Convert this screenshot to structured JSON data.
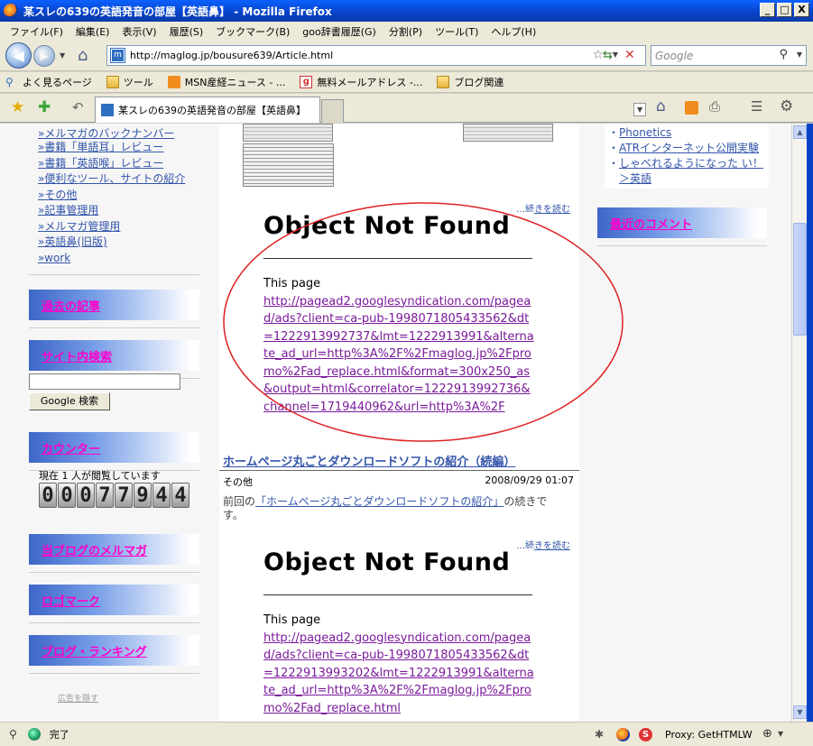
{
  "window": {
    "title": "某スレの639の英語発音の部屋【英語鼻】 - Mozilla Firefox",
    "min": "_",
    "max": "□",
    "close": "X"
  },
  "menu": [
    "ファイル(F)",
    "編集(E)",
    "表示(V)",
    "履歴(S)",
    "ブックマーク(B)",
    "goo辞書履歴(G)",
    "分割(P)",
    "ツール(T)",
    "ヘルプ(H)"
  ],
  "nav": {
    "url": "http://maglog.jp/bousure639/Article.html",
    "search_placeholder": "Google"
  },
  "bookmarks": [
    "よく見るページ",
    "ツール",
    "MSN産経ニュース - ...",
    "無料メールアドレス -...",
    "ブログ関連"
  ],
  "tab": {
    "label": "某スレの639の英語発音の部屋【英語鼻】"
  },
  "left_sidebar": {
    "links": [
      "»メルマガのバックナンバー",
      "»書籍「単語耳」レビュー",
      "»書籍「英語喉」レビュー",
      "»便利なツール、サイトの紹介",
      "»その他",
      "»記事管理用",
      "»メルマガ管理用",
      "»英語鼻(旧版)",
      "»work"
    ],
    "past_articles": "過去の記事",
    "site_search": "サイト内検索",
    "search_button": "Google 検索",
    "counter_title": "カウンター",
    "counter_text": "現在 1 人が閲覧しています",
    "counter_digits": "00077944",
    "mailmag": "当ブログのメルマガ",
    "logo": "ロゴマーク",
    "ranking": "ブログ・ランキング",
    "hide_ad": "広告を隠す"
  },
  "main": {
    "more1": "…続きを読む",
    "error1": {
      "title": "Object Not Found",
      "intro": "This page",
      "url": "http://pagead2.googlesyndication.com/pagead/ads?client=ca-pub-1998071805433562&dt=1222913992737&lmt=1222913991&alternate_ad_url=http%3A%2F%2Fmaglog.jp%2Fpromo%2Fad_replace.html&format=300x250_as&output=html&correlator=1222913992736&channel=1719440962&url=http%3A%2F"
    },
    "article_title": "ホームページ丸ごとダウンロードソフトの紹介（続編）",
    "category": "その他",
    "date": "2008/09/29 01:07",
    "body_prefix": "前回の",
    "body_link": "「ホームページ丸ごとダウンロードソフトの紹介」",
    "body_suffix": "の続きです。",
    "more2": "…続きを読む",
    "error2": {
      "title": "Object Not Found",
      "intro": "This page",
      "url": "http://pagead2.googlesyndication.com/pagead/ads?client=ca-pub-1998071805433562&dt=1222913993202&lmt=1222913991&alternate_ad_url=http%3A%2F%2Fmaglog.jp%2Fpromo%2Fad_replace.html"
    }
  },
  "right_sidebar": {
    "items": [
      "Phonetics",
      "ATRインターネット公開実験",
      "しゃべれるようになった い！＞英語"
    ],
    "recent_comments": "最近のコメント"
  },
  "status": {
    "text": "完了",
    "proxy": "Proxy: GetHTMLW"
  }
}
